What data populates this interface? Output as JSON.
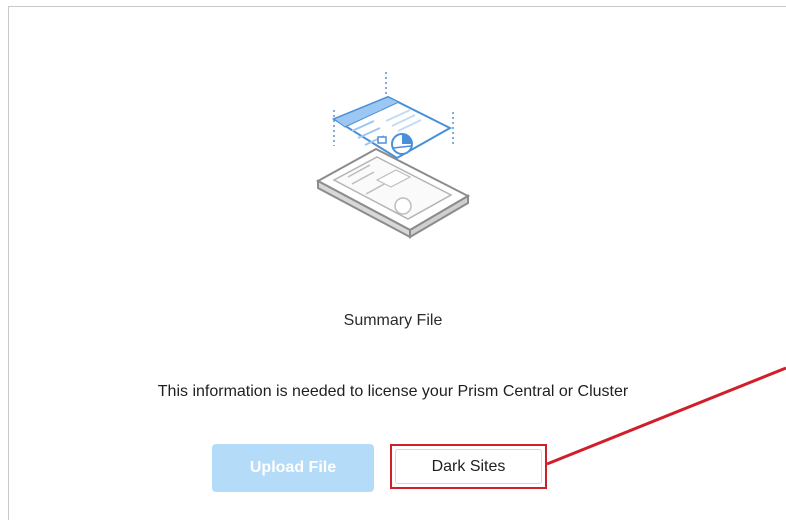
{
  "summary": {
    "title": "Summary File",
    "description": "This information is needed to license your Prism Central or Cluster"
  },
  "actions": {
    "upload_label": "Upload File",
    "dark_sites_label": "Dark Sites"
  },
  "colors": {
    "annotation": "#d01f2a",
    "upload_disabled": "#b4dbf8",
    "illustration_blue": "#4a90d9",
    "illustration_gray": "#8c8c8c"
  },
  "icons": {
    "illustration": "summary-file-illustration-icon"
  }
}
